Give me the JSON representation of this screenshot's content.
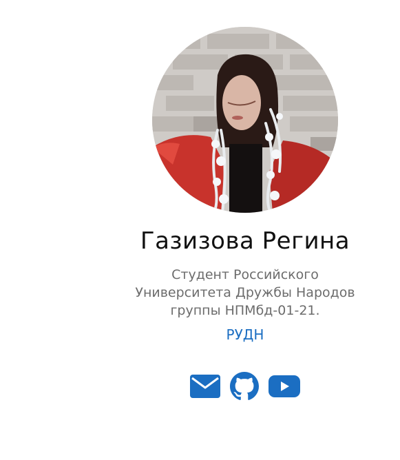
{
  "profile": {
    "name": "Газизова Регина",
    "bio_lines": [
      "Студент Российского",
      "Университета Дружбы Народов",
      "группы НПМбд-01-21."
    ],
    "organization": "РУДН",
    "accent_color": "#1b6ec2"
  },
  "social_links": [
    {
      "icon": "envelope-icon"
    },
    {
      "icon": "github-icon"
    },
    {
      "icon": "youtube-icon"
    }
  ]
}
